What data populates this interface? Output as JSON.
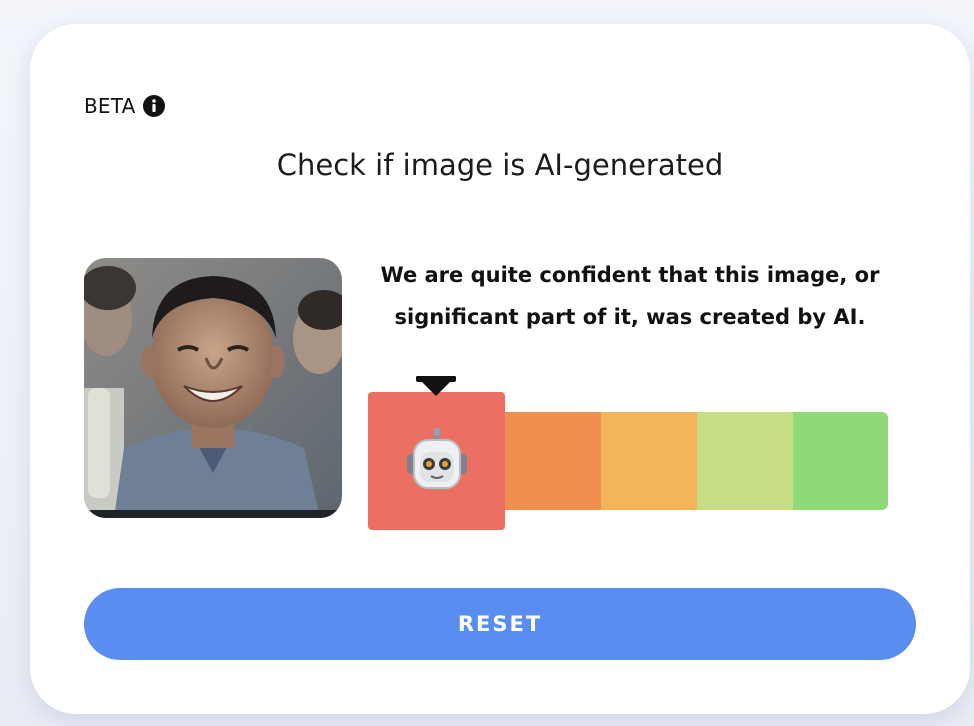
{
  "badge": {
    "label": "BETA",
    "icon": "info-icon"
  },
  "title": "Check if image is AI-generated",
  "result": {
    "line1": "We are quite confident that this image, or",
    "line2": "significant part of it, was created by AI."
  },
  "meter": {
    "segments": [
      {
        "color": "#ec6f63"
      },
      {
        "color": "#f0904e"
      },
      {
        "color": "#f3b55a"
      },
      {
        "color": "#c6dd85"
      },
      {
        "color": "#8fd978"
      }
    ],
    "active_index": 0,
    "indicator_icon": "robot-icon"
  },
  "reset_button": {
    "label": "RESET"
  },
  "colors": {
    "accent": "#5a8df0",
    "card": "#ffffff"
  }
}
